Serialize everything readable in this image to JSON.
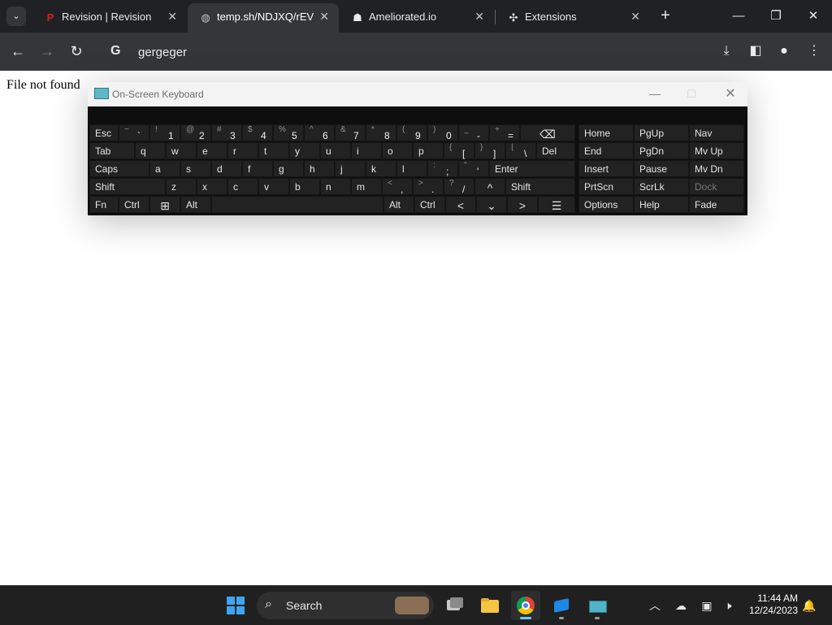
{
  "browser": {
    "tabs": [
      {
        "title": "Revision | Revision",
        "favicon": "revision-logo-icon",
        "active": false
      },
      {
        "title": "temp.sh/NDJXQ/rEVI-p",
        "favicon": "globe-icon",
        "active": true
      },
      {
        "title": "Ameliorated.io",
        "favicon": "ameliorated-logo-icon",
        "active": false
      },
      {
        "title": "Extensions",
        "favicon": "puzzle-icon",
        "active": false
      }
    ],
    "omnibox_text": "gergeger",
    "omnibox_provider": "G"
  },
  "page": {
    "body_text": "File not found"
  },
  "osk": {
    "title": "On-Screen Keyboard",
    "rows": [
      [
        {
          "label": "Esc"
        },
        {
          "top": "~",
          "main": "`"
        },
        {
          "top": "!",
          "main": "1"
        },
        {
          "top": "@",
          "main": "2"
        },
        {
          "top": "#",
          "main": "3"
        },
        {
          "top": "$",
          "main": "4"
        },
        {
          "top": "%",
          "main": "5"
        },
        {
          "top": "^",
          "main": "6"
        },
        {
          "top": "&",
          "main": "7"
        },
        {
          "top": "*",
          "main": "8"
        },
        {
          "top": "(",
          "main": "9"
        },
        {
          "top": ")",
          "main": "0"
        },
        {
          "top": "_",
          "main": "-"
        },
        {
          "top": "+",
          "main": "="
        },
        {
          "label": "⌫"
        }
      ],
      [
        {
          "label": "Tab"
        },
        {
          "label": "q"
        },
        {
          "label": "w"
        },
        {
          "label": "e"
        },
        {
          "label": "r"
        },
        {
          "label": "t"
        },
        {
          "label": "y"
        },
        {
          "label": "u"
        },
        {
          "label": "i"
        },
        {
          "label": "o"
        },
        {
          "label": "p"
        },
        {
          "top": "{",
          "main": "["
        },
        {
          "top": "}",
          "main": "]"
        },
        {
          "top": "|",
          "main": "\\"
        },
        {
          "label": "Del"
        }
      ],
      [
        {
          "label": "Caps"
        },
        {
          "label": "a"
        },
        {
          "label": "s"
        },
        {
          "label": "d"
        },
        {
          "label": "f"
        },
        {
          "label": "g"
        },
        {
          "label": "h"
        },
        {
          "label": "j"
        },
        {
          "label": "k"
        },
        {
          "label": "l"
        },
        {
          "top": ":",
          "main": ";"
        },
        {
          "top": "\"",
          "main": "'"
        },
        {
          "label": "Enter"
        }
      ],
      [
        {
          "label": "Shift"
        },
        {
          "label": "z"
        },
        {
          "label": "x"
        },
        {
          "label": "c"
        },
        {
          "label": "v"
        },
        {
          "label": "b"
        },
        {
          "label": "n"
        },
        {
          "label": "m"
        },
        {
          "top": "<",
          "main": ","
        },
        {
          "top": ">",
          "main": "."
        },
        {
          "top": "?",
          "main": "/"
        },
        {
          "label": "^"
        },
        {
          "label": "Shift"
        }
      ],
      [
        {
          "label": "Fn"
        },
        {
          "label": "Ctrl"
        },
        {
          "label": "⊞"
        },
        {
          "label": "Alt"
        },
        {
          "label": ""
        },
        {
          "label": "Alt"
        },
        {
          "label": "Ctrl"
        },
        {
          "label": "<"
        },
        {
          "label": "⌄"
        },
        {
          "label": ">"
        },
        {
          "label": "☰"
        }
      ]
    ],
    "nav_rows": [
      [
        "Home",
        "PgUp",
        "Nav"
      ],
      [
        "End",
        "PgDn",
        "Mv Up"
      ],
      [
        "Insert",
        "Pause",
        "Mv Dn"
      ],
      [
        "PrtScn",
        "ScrLk",
        "Dock"
      ],
      [
        "Options",
        "Help",
        "Fade"
      ]
    ]
  },
  "taskbar": {
    "search_label": "Search",
    "time": "11:44 AM",
    "date": "12/24/2023"
  }
}
